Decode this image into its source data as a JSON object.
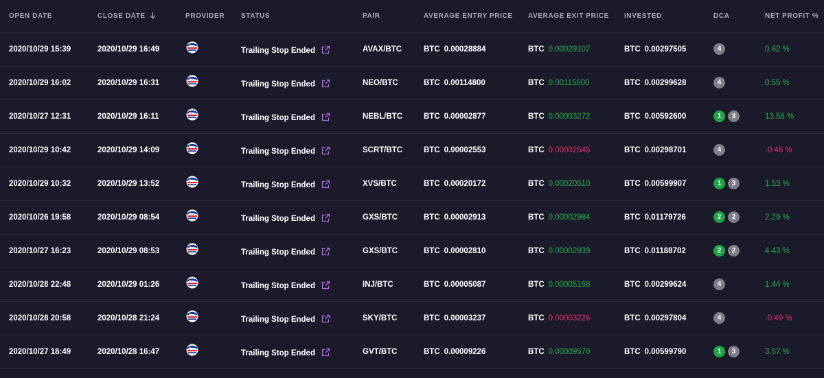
{
  "columns": {
    "open_date": "OPEN DATE",
    "close_date": "CLOSE DATE",
    "provider": "PROVIDER",
    "status": "STATUS",
    "pair": "PAIR",
    "entry": "AVERAGE ENTRY PRICE",
    "exit": "AVERAGE EXIT PRICE",
    "invested": "INVESTED",
    "dca": "DCA",
    "net_profit": "NET PROFIT %"
  },
  "currency": "BTC",
  "colors": {
    "positive": "#22b24c",
    "negative": "#e3336b",
    "link": "#b26ae6",
    "background": "#1b1a2a"
  },
  "icons": {
    "sort": "arrow-down-icon",
    "status_link": "external-link-icon",
    "provider": "provider-avatar-icon"
  },
  "rows": [
    {
      "open": "2020/10/29 15:39",
      "close": "2020/10/29 16:49",
      "status": "Trailing Stop Ended",
      "pair": "AVAX/BTC",
      "entry": "0.00028884",
      "exit": "0.00029107",
      "exit_dir": "pos",
      "invested": "0.00297505",
      "dca": [
        {
          "v": "4",
          "c": "gray"
        }
      ],
      "np": "0.62 %",
      "np_dir": "pos"
    },
    {
      "open": "2020/10/29 16:02",
      "close": "2020/10/29 16:31",
      "status": "Trailing Stop Ended",
      "pair": "NEO/BTC",
      "entry": "0.00114800",
      "exit": "0.00115600",
      "exit_dir": "pos",
      "invested": "0.00299628",
      "dca": [
        {
          "v": "4",
          "c": "gray"
        }
      ],
      "np": "0.55 %",
      "np_dir": "pos"
    },
    {
      "open": "2020/10/27 12:31",
      "close": "2020/10/29 16:11",
      "status": "Trailing Stop Ended",
      "pair": "NEBL/BTC",
      "entry": "0.00002877",
      "exit": "0.00003272",
      "exit_dir": "pos",
      "invested": "0.00592600",
      "dca": [
        {
          "v": "1",
          "c": "green"
        },
        {
          "v": "3",
          "c": "gray"
        }
      ],
      "np": "13.58 %",
      "np_dir": "pos"
    },
    {
      "open": "2020/10/29 10:42",
      "close": "2020/10/29 14:09",
      "status": "Trailing Stop Ended",
      "pair": "SCRT/BTC",
      "entry": "0.00002553",
      "exit": "0.00002545",
      "exit_dir": "neg",
      "invested": "0.00298701",
      "dca": [
        {
          "v": "4",
          "c": "gray"
        }
      ],
      "np": "-0.46 %",
      "np_dir": "neg"
    },
    {
      "open": "2020/10/29 10:32",
      "close": "2020/10/29 13:52",
      "status": "Trailing Stop Ended",
      "pair": "XVS/BTC",
      "entry": "0.00020172",
      "exit": "0.00020510",
      "exit_dir": "pos",
      "invested": "0.00599907",
      "dca": [
        {
          "v": "1",
          "c": "green"
        },
        {
          "v": "3",
          "c": "gray"
        }
      ],
      "np": "1.53 %",
      "np_dir": "pos"
    },
    {
      "open": "2020/10/26 19:58",
      "close": "2020/10/29 08:54",
      "status": "Trailing Stop Ended",
      "pair": "GXS/BTC",
      "entry": "0.00002913",
      "exit": "0.00002984",
      "exit_dir": "pos",
      "invested": "0.01179726",
      "dca": [
        {
          "v": "2",
          "c": "green"
        },
        {
          "v": "2",
          "c": "gray"
        }
      ],
      "np": "2.29 %",
      "np_dir": "pos"
    },
    {
      "open": "2020/10/27 16:23",
      "close": "2020/10/29 08:53",
      "status": "Trailing Stop Ended",
      "pair": "GXS/BTC",
      "entry": "0.00002810",
      "exit": "0.00002939",
      "exit_dir": "pos",
      "invested": "0.01188702",
      "dca": [
        {
          "v": "2",
          "c": "green"
        },
        {
          "v": "2",
          "c": "gray"
        }
      ],
      "np": "4.43 %",
      "np_dir": "pos"
    },
    {
      "open": "2020/10/28 22:48",
      "close": "2020/10/29 01:26",
      "status": "Trailing Stop Ended",
      "pair": "INJ/BTC",
      "entry": "0.00005087",
      "exit": "0.00005168",
      "exit_dir": "pos",
      "invested": "0.00299624",
      "dca": [
        {
          "v": "4",
          "c": "gray"
        }
      ],
      "np": "1.44 %",
      "np_dir": "pos"
    },
    {
      "open": "2020/10/28 20:58",
      "close": "2020/10/28 21:24",
      "status": "Trailing Stop Ended",
      "pair": "SKY/BTC",
      "entry": "0.00003237",
      "exit": "0.00003226",
      "exit_dir": "neg",
      "invested": "0.00297804",
      "dca": [
        {
          "v": "4",
          "c": "gray"
        }
      ],
      "np": "-0.49 %",
      "np_dir": "neg"
    },
    {
      "open": "2020/10/27 18:49",
      "close": "2020/10/28 16:47",
      "status": "Trailing Stop Ended",
      "pair": "GVT/BTC",
      "entry": "0.00009226",
      "exit": "0.00009570",
      "exit_dir": "pos",
      "invested": "0.00599790",
      "dca": [
        {
          "v": "1",
          "c": "green"
        },
        {
          "v": "3",
          "c": "gray"
        }
      ],
      "np": "3.57 %",
      "np_dir": "pos"
    }
  ]
}
